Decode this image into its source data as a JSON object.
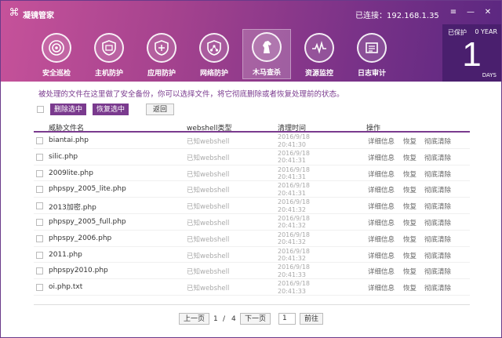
{
  "app": {
    "title": "凝镜管家",
    "connection": "已连接：192.168.1.35",
    "controls": [
      "≡",
      "—",
      "✕"
    ]
  },
  "nav": [
    {
      "label": "安全巡检",
      "icon": "radar-icon"
    },
    {
      "label": "主机防护",
      "icon": "shield-icon"
    },
    {
      "label": "应用防护",
      "icon": "app-shield-icon"
    },
    {
      "label": "网络防护",
      "icon": "network-icon"
    },
    {
      "label": "木马查杀",
      "icon": "horse-icon",
      "active": true
    },
    {
      "label": "资源监控",
      "icon": "monitor-icon"
    },
    {
      "label": "日志审计",
      "icon": "log-icon"
    }
  ],
  "protection": {
    "label": "已保护",
    "years": "0 YEAR",
    "days_number": "1",
    "days_label": "DAYS"
  },
  "notice": "被处理的文件在这里做了安全备份，你可以选择文件，将它彻底删除或者恢复处理前的状态。",
  "toolbar": {
    "delete_selected": "删除选中",
    "restore_selected": "恢复选中",
    "back": "返回"
  },
  "table": {
    "headers": {
      "name": "威胁文件名",
      "type": "webshell类型",
      "time": "清理时间",
      "action": "操作"
    },
    "actions": {
      "details": "详细信息",
      "restore": "恢复",
      "delete": "彻底清除"
    },
    "rows": [
      {
        "name": "biantai.php",
        "type": "已知webshell",
        "date": "2016/9/18",
        "time": "20:41:30"
      },
      {
        "name": "silic.php",
        "type": "已知webshell",
        "date": "2016/9/18",
        "time": "20:41:31"
      },
      {
        "name": "2009lite.php",
        "type": "已知webshell",
        "date": "2016/9/18",
        "time": "20:41:31"
      },
      {
        "name": "phpspy_2005_lite.php",
        "type": "已知webshell",
        "date": "2016/9/18",
        "time": "20:41:31"
      },
      {
        "name": "2013加密.php",
        "type": "已知webshell",
        "date": "2016/9/18",
        "time": "20:41:32"
      },
      {
        "name": "phpspy_2005_full.php",
        "type": "已知webshell",
        "date": "2016/9/18",
        "time": "20:41:32"
      },
      {
        "name": "phpspy_2006.php",
        "type": "已知webshell",
        "date": "2016/9/18",
        "time": "20:41:32"
      },
      {
        "name": "2011.php",
        "type": "已知webshell",
        "date": "2016/9/18",
        "time": "20:41:32"
      },
      {
        "name": "phpspy2010.php",
        "type": "已知webshell",
        "date": "2016/9/18",
        "time": "20:41:33"
      },
      {
        "name": "oi.php.txt",
        "type": "已知webshell",
        "date": "2016/9/18",
        "time": "20:41:33"
      }
    ]
  },
  "pager": {
    "prev": "上一页",
    "current": "1",
    "separator": "/",
    "total": "4",
    "next": "下一页",
    "input_value": "1",
    "go": "前往"
  }
}
